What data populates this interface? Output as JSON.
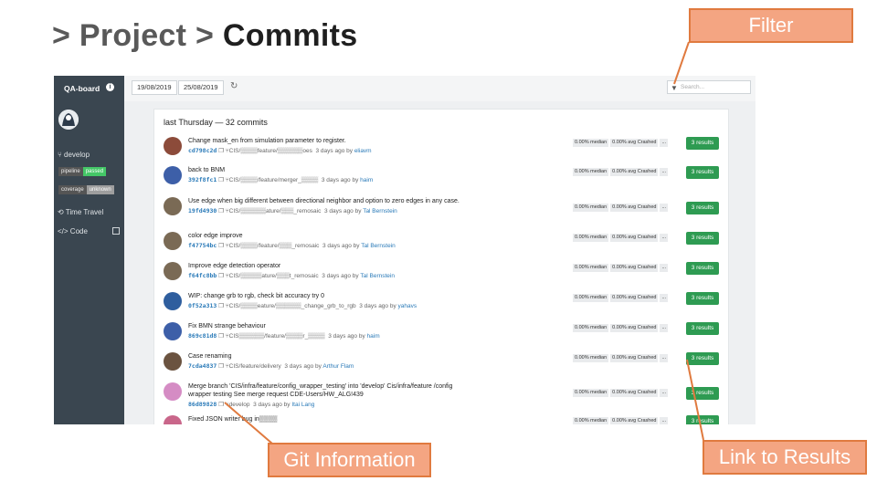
{
  "slide": {
    "prefix": "> Project > ",
    "current": "Commits"
  },
  "callouts": {
    "filter": "Filter",
    "git": "Git Information",
    "results": "Link to Results"
  },
  "sidebar": {
    "title": "QA-board",
    "branch": "develop",
    "badges": [
      {
        "key": "pipeline",
        "value": "passed"
      },
      {
        "key": "coverage",
        "value": "unknown"
      }
    ],
    "links": [
      "Time Travel",
      "Code"
    ]
  },
  "topbar": {
    "date_from": "19/08/2019",
    "date_to": "25/08/2019",
    "search_placeholder": "Search..."
  },
  "panel": {
    "title": "last Thursday — 32 commits"
  },
  "stats_labels": {
    "median": "0.00% median",
    "crashed": "0.00% avg Crashed",
    "more": "...",
    "results": "3 results"
  },
  "commits": [
    {
      "msg": "Change mask_en from simulation parameter to register.",
      "hash": "cd798c2d",
      "branch": "CIS/▒▒▒▒feature/▒▒▒▒▒▒oes",
      "when": "3 days ago by",
      "author": "eliavm",
      "avatar_color": "#8c4b3a"
    },
    {
      "msg": "back to BNM",
      "hash": "392f8fc1",
      "branch": "CIS/▒▒▒▒/feature/merger_▒▒▒▒",
      "when": "3 days ago by",
      "author": "haim",
      "avatar_color": "#3d5fa8"
    },
    {
      "msg": "Use edge when big different between directional neighbor and option to zero edges in any case.",
      "hash": "19fd4930",
      "branch": "CIS/▒▒▒▒▒▒ature/▒▒▒_remosaic",
      "when": "3 days ago by",
      "author": "Tal Bernstein",
      "avatar_color": "#7a6a55"
    },
    {
      "msg": "color edge improve",
      "hash": "f47754bc",
      "branch": "CIS/▒▒▒▒/feature/▒▒▒_remosaic",
      "when": "3 days ago by",
      "author": "Tal Bernstein",
      "avatar_color": "#7a6a55"
    },
    {
      "msg": "Improve edge detection operator",
      "hash": "f64fc8bb",
      "branch": "CIS/▒▒▒▒▒ature/▒▒▒t_remosaic",
      "when": "3 days ago by",
      "author": "Tal Bernstein",
      "avatar_color": "#7a6a55"
    },
    {
      "msg": "WIP: change grb to rgb, check bit accuracy try 0",
      "hash": "0f52a313",
      "branch": "CIS/▒▒▒▒eature/▒▒▒▒▒▒_change_grb_to_rgb",
      "when": "3 days ago by",
      "author": "yahavs",
      "avatar_color": "#2f5e9e"
    },
    {
      "msg": "Fix BMN strange behaviour",
      "hash": "869c81d8",
      "branch": "CIS▒▒▒▒▒▒/feature/▒▒▒▒r_▒▒▒▒",
      "when": "3 days ago by",
      "author": "haim",
      "avatar_color": "#3d5fa8"
    },
    {
      "msg": "Case renaming",
      "hash": "7cda4837",
      "branch": "CIS/feature/delivery",
      "when": "3 days ago by",
      "author": "Arthur Flam",
      "avatar_color": "#6b5340"
    },
    {
      "msg": "Merge branch 'CIS/infra/feature/config_wrapper_testing' into 'develop' Cis/infra/feature /config wrapper testing See merge request CDE-Users/HW_ALG!439",
      "hash": "86d89828",
      "branch": "develop",
      "when": "3 days ago by",
      "author": "Itai Lang",
      "avatar_color": "#d58cc4"
    },
    {
      "msg": "Fixed JSON writer bug in▒▒▒▒",
      "hash": "",
      "branch": "",
      "when": "",
      "author": "",
      "avatar_color": "#c9668a"
    }
  ],
  "colors": {
    "sidebar": "#3a4650",
    "accent_green": "#2e9b52",
    "link_blue": "#2a7ab8",
    "callout": "#f4a582"
  }
}
